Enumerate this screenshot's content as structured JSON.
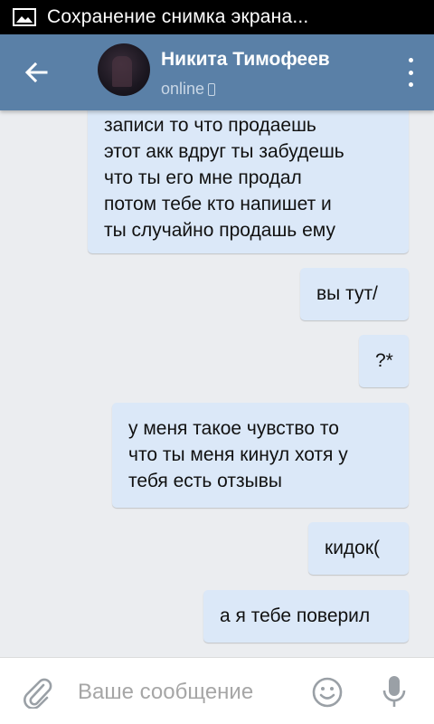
{
  "status_bar": {
    "notification_icon": "image-icon",
    "text": "Сохранение снимка экрана..."
  },
  "header": {
    "back_icon": "arrow-left-icon",
    "contact_name": "Никита Тимофеев",
    "status": "online",
    "status_icon": "phone-icon",
    "menu_icon": "more-vert-icon"
  },
  "messages": [
    {
      "text": "записи то что продаешь\nэтот акк вдруг ты забудешь\nчто ты его мне продал\nпотом тебе кто напишет и\nты случайно продашь ему"
    },
    {
      "text": "вы тут/"
    },
    {
      "text": "?*"
    },
    {
      "text": "у меня такое чувство то\nчто ты меня кинул хотя у\nтебя есть отзывы"
    },
    {
      "text": "кидок("
    },
    {
      "text": "а я тебе поверил"
    }
  ],
  "input_bar": {
    "placeholder": "Ваше сообщение",
    "attach_icon": "paperclip-icon",
    "emoji_icon": "smile-icon",
    "mic_icon": "microphone-icon"
  },
  "colors": {
    "header": "#5a80a7",
    "bubble_out": "#dbe8f8",
    "chat_background": "#ebedf0"
  }
}
